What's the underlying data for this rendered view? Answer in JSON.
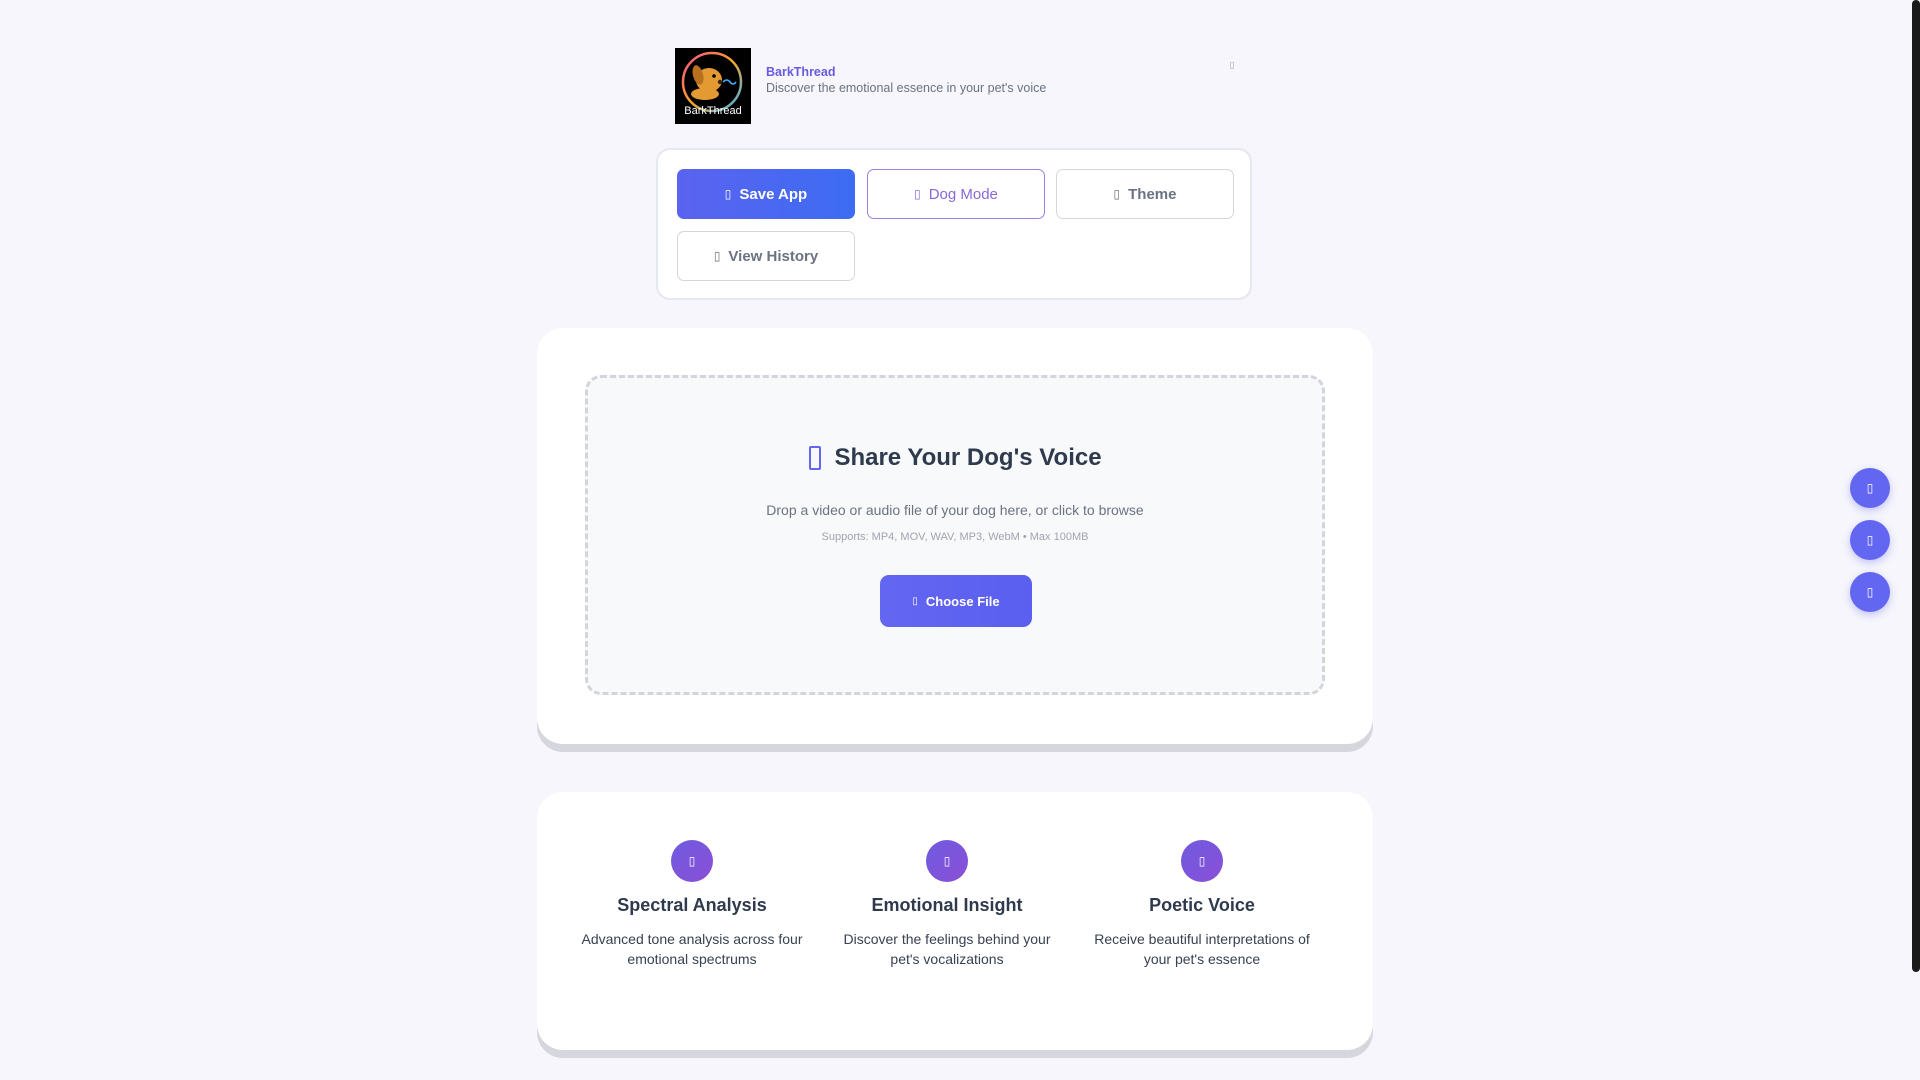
{
  "header": {
    "brand_name": "BarkThread",
    "tagline": "Discover the emotional essence in your pet's voice",
    "logo_text": "BarkThread",
    "menu_icon": "ellipsis-icon"
  },
  "toolbar": {
    "buttons": [
      {
        "label": "Save App",
        "icon": "save-icon"
      },
      {
        "label": "Dog Mode",
        "icon": "paw-icon"
      },
      {
        "label": "Theme",
        "icon": "palette-icon"
      },
      {
        "label": "View History",
        "icon": "history-icon"
      }
    ]
  },
  "upload": {
    "title": "Share Your Dog's Voice",
    "description": "Drop a video or audio file of your dog here, or click to browse",
    "supports": "Supports: MP4, MOV, WAV, MP3, WebM • Max 100MB",
    "button_label": "Choose File",
    "icon": "microphone-icon"
  },
  "features": [
    {
      "title": "Spectral Analysis",
      "description": "Advanced tone analysis across four emotional spectrums",
      "icon": "wave-icon"
    },
    {
      "title": "Emotional Insight",
      "description": "Discover the feelings behind your pet's vocalizations",
      "icon": "heart-icon"
    },
    {
      "title": "Poetic Voice",
      "description": "Receive beautiful interpretations of your pet's essence",
      "icon": "feather-icon"
    }
  ],
  "side_buttons": [
    "help-icon",
    "share-icon",
    "settings-icon"
  ],
  "colors": {
    "accent": "#6366f1",
    "brand": "#6a5ae0",
    "feature_gradient_start": "#6f5be0",
    "feature_gradient_end": "#8a4fd6"
  }
}
